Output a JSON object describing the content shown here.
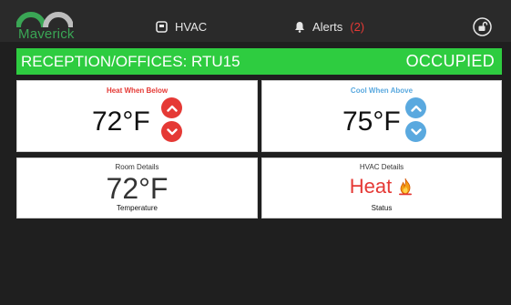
{
  "header": {
    "logo_text": "Maverick",
    "hvac_label": "HVAC",
    "alerts_label": "Alerts",
    "alerts_count": "(2)"
  },
  "banner": {
    "title": "RECEPTION/OFFICES: RTU15",
    "status": "OCCUPIED"
  },
  "heat": {
    "label": "Heat When Below",
    "setpoint": "72°F"
  },
  "cool": {
    "label": "Cool When Above",
    "setpoint": "75°F"
  },
  "room": {
    "title": "Room Details",
    "temperature": "72°F",
    "sub_label": "Temperature"
  },
  "hvac_details": {
    "title": "HVAC Details",
    "status": "Heat",
    "sub_label": "Status"
  },
  "icons": {
    "hvac": "thermostat-icon",
    "alerts": "bell-icon",
    "lock": "unlock-icon",
    "increase": "chevron-up-icon",
    "decrease": "chevron-down-icon",
    "heat_status": "flame-icon"
  },
  "colors": {
    "background": "#1f1f1f",
    "topbar": "#2a2a2a",
    "banner": "#2ecc40",
    "heat": "#e53935",
    "cool": "#5aa9df",
    "logo": "#3aa655"
  }
}
